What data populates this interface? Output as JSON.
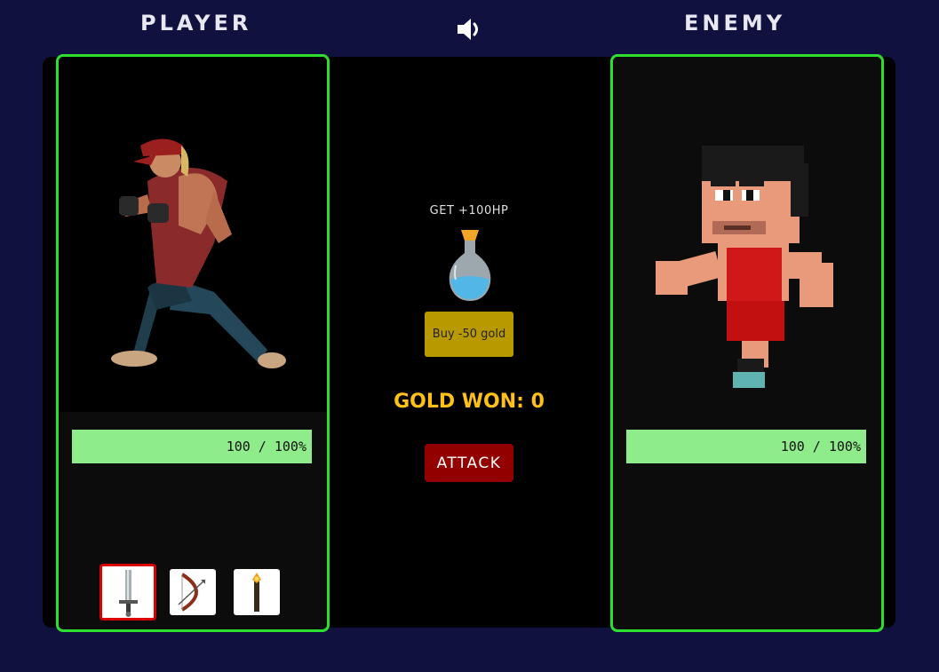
{
  "header": {
    "player_title": "PLAYER",
    "enemy_title": "ENEMY",
    "sound_icon": "speaker-volume-icon"
  },
  "player": {
    "hp_text": "100 / 100%",
    "hp_fraction": 1.0,
    "weapons": [
      {
        "name": "sword-icon",
        "selected": true
      },
      {
        "name": "bow-icon",
        "selected": false
      },
      {
        "name": "staff-icon",
        "selected": false
      }
    ]
  },
  "enemy": {
    "hp_text": "100 / 100%",
    "hp_fraction": 1.0
  },
  "shop": {
    "label": "GET +100HP",
    "buy_label": "Buy -50 gold",
    "potion_icon": "potion-icon"
  },
  "gold_won": "GOLD WON: 0",
  "attack_label": "ATTACK",
  "colors": {
    "background": "#10113f",
    "panel_border": "#2ee02e",
    "hp_bar": "#8fec8b",
    "gold_text": "#ffc116",
    "buy_button": "#b89900",
    "attack_button": "#930000",
    "selected_weapon_border": "#d90000"
  }
}
